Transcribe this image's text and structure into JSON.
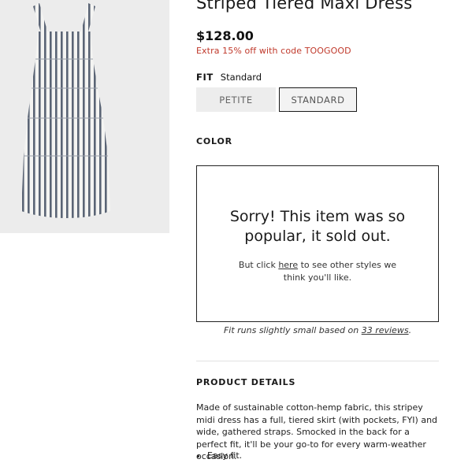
{
  "product": {
    "title": "Striped Tiered Maxi Dress",
    "price": "$128.00",
    "promo": "Extra 15% off with code TOOGOOD"
  },
  "fit": {
    "label": "FIT",
    "selected_value": "Standard",
    "options": [
      "PETITE",
      "STANDARD"
    ]
  },
  "color": {
    "label": "COLOR"
  },
  "sold_out": {
    "message": "Sorry! This item was so popular, it sold out.",
    "sub_prefix": "But click ",
    "sub_link": "here",
    "sub_suffix": " to see other styles we think you'll like."
  },
  "fit_note": {
    "prefix": "Fit runs slightly small based on ",
    "link": "33 reviews",
    "suffix": "."
  },
  "details": {
    "heading": "PRODUCT DETAILS",
    "body": "Made of sustainable cotton-hemp fabric, this stripey midi dress has a full, tiered skirt (with pockets, FYI) and wide, gathered straps. Smocked in the back for a perfect fit, it'll be your go-to for every warm-weather occasion.",
    "bullets": [
      "Easy fit."
    ]
  },
  "colors": {
    "promo_red": "#c0392b",
    "dress_stripe": "#5a6475",
    "gallery_bg": "#ececec"
  }
}
